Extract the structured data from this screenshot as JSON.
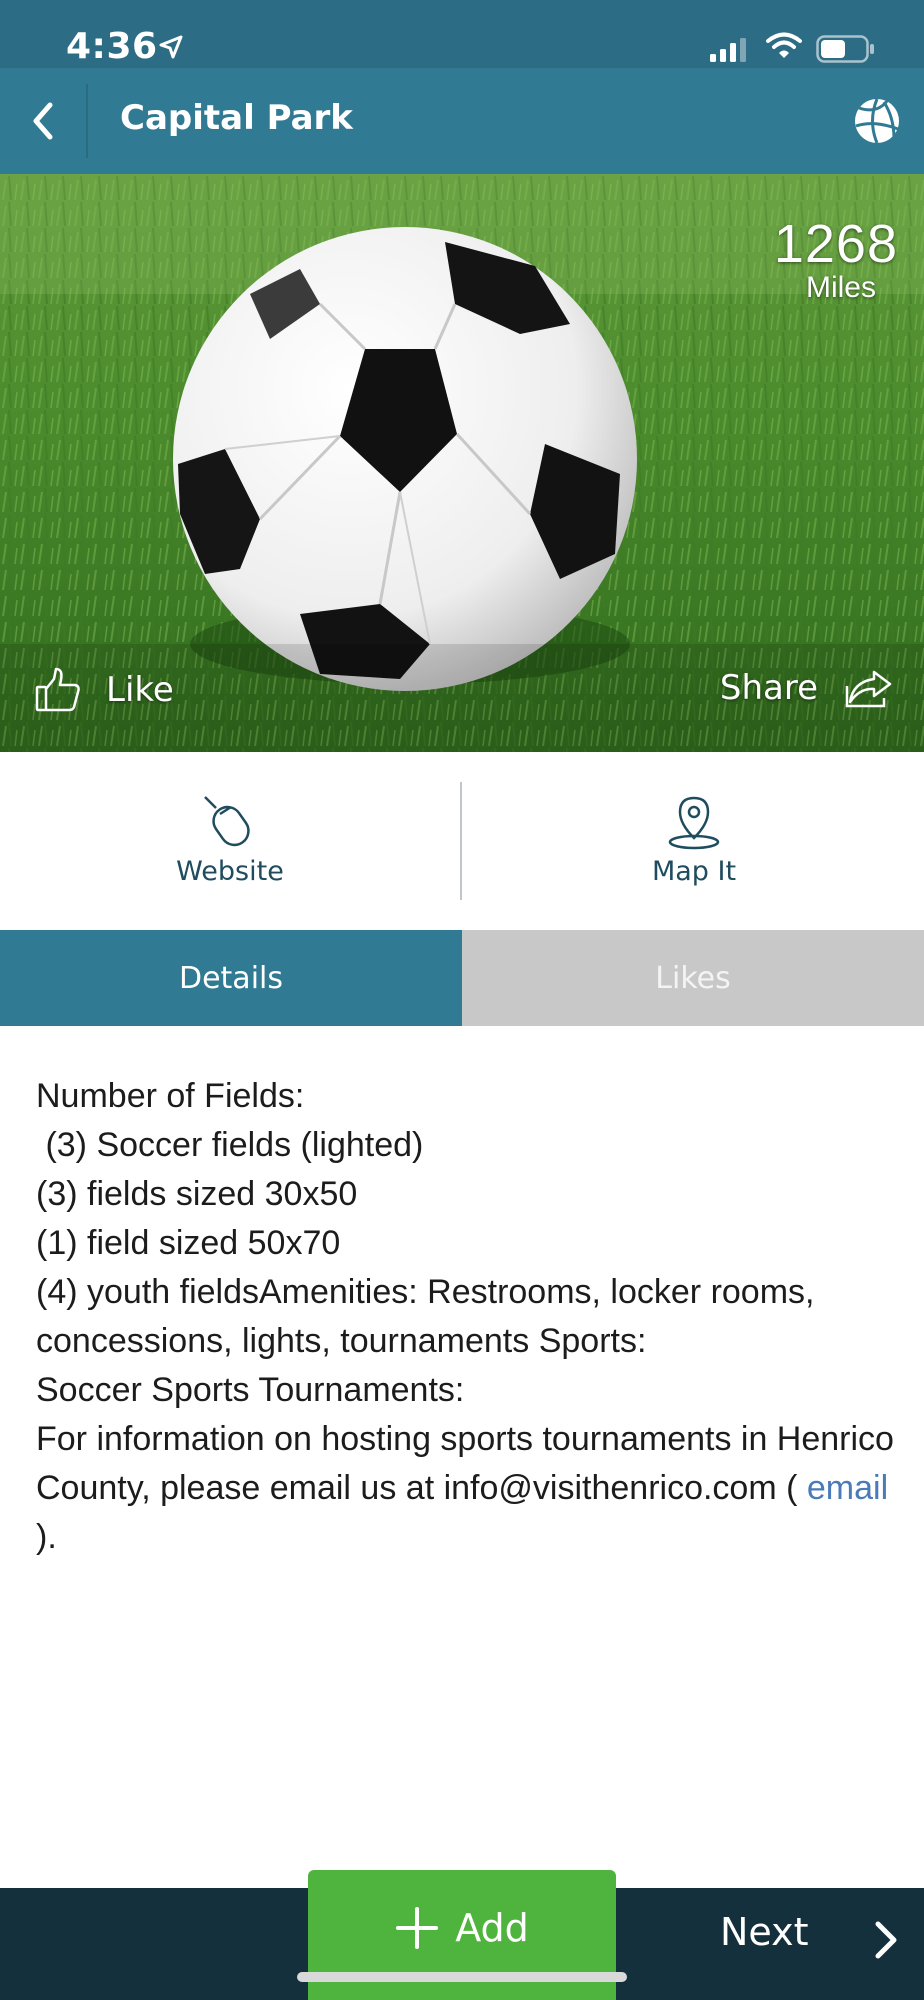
{
  "status_bar": {
    "time": "4:36",
    "icons": [
      "location-arrow-icon",
      "cellular-signal-icon",
      "wifi-icon",
      "battery-icon"
    ]
  },
  "nav": {
    "title": "Capital Park",
    "back_icon": "chevron-left-icon",
    "sport_icon": "basketball-icon"
  },
  "hero": {
    "image": "soccer-ball-on-grass",
    "distance_value": "1268",
    "distance_unit": "Miles",
    "like_label": "Like",
    "share_label": "Share"
  },
  "actions": {
    "website_label": "Website",
    "map_label": "Map It"
  },
  "tabs": [
    {
      "label": "Details",
      "active": true
    },
    {
      "label": "Likes",
      "active": false
    }
  ],
  "details": {
    "lines": [
      "Number of Fields:",
      " (3) Soccer fields (lighted)",
      "(3) fields sized 30x50",
      "(1) field sized 50x70",
      "(4) youth fieldsAmenities: Restrooms, locker rooms, concessions, lights, tournaments Sports:",
      "Soccer Sports Tournaments:"
    ],
    "tournament_text": "For information on hosting sports tournaments in Henrico County, please email us at info@visithenrico.com (",
    "email_link": "email",
    "tournament_tail": ")."
  },
  "bottom": {
    "add_label": "Add",
    "next_label": "Next"
  },
  "colors": {
    "header": "#317a93",
    "status": "#2c6c85",
    "tab_inactive": "#c8c8c8",
    "add_button": "#4fb43d",
    "bottom_bar": "#14303d",
    "link": "#4a7bb8"
  }
}
